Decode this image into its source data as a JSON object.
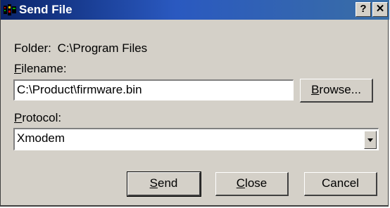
{
  "window": {
    "title": "Send File",
    "help_label": "?",
    "close_label": "✕"
  },
  "folder": {
    "label": "Folder:",
    "value": "C:\\Program Files"
  },
  "filename": {
    "label_mnemonic": "F",
    "label_rest": "ilename:",
    "value": "C:\\Product\\firmware.bin"
  },
  "browse": {
    "mnemonic": "B",
    "rest": "rowse..."
  },
  "protocol": {
    "label_mnemonic": "P",
    "label_rest": "rotocol:",
    "selected": "Xmodem"
  },
  "buttons": {
    "send": {
      "mnemonic": "S",
      "rest": "end"
    },
    "close": {
      "mnemonic": "C",
      "rest": "lose"
    },
    "cancel": {
      "label": "Cancel"
    }
  }
}
